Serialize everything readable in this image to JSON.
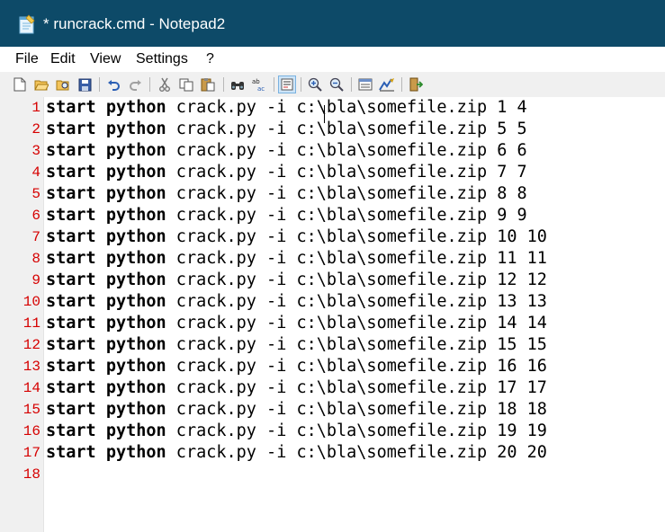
{
  "window": {
    "title": "* runcrack.cmd - Notepad2"
  },
  "menu": [
    {
      "label": "File"
    },
    {
      "label": "Edit"
    },
    {
      "label": "View"
    },
    {
      "label": "Settings"
    },
    {
      "label": "?"
    }
  ],
  "toolbar": {
    "buttons": [
      {
        "name": "new-file-icon"
      },
      {
        "name": "open-folder-icon"
      },
      {
        "name": "browse-icon"
      },
      {
        "name": "save-icon"
      },
      {
        "name": "undo-icon"
      },
      {
        "name": "redo-icon"
      },
      {
        "name": "cut-icon"
      },
      {
        "name": "copy-icon"
      },
      {
        "name": "paste-icon"
      },
      {
        "name": "find-icon"
      },
      {
        "name": "replace-icon"
      },
      {
        "name": "word-wrap-icon"
      },
      {
        "name": "zoom-in-icon"
      },
      {
        "name": "zoom-out-icon"
      },
      {
        "name": "scheme-icon"
      },
      {
        "name": "customize-schemes-icon"
      },
      {
        "name": "exit-icon"
      }
    ]
  },
  "editor": {
    "lines": [
      {
        "num": "1",
        "kw1": "start",
        "kw2": "python",
        "rest": " crack.py -i c:\\bla\\somefile.zip 1 4"
      },
      {
        "num": "2",
        "kw1": "start",
        "kw2": "python",
        "rest": " crack.py -i c:\\bla\\somefile.zip 5 5"
      },
      {
        "num": "3",
        "kw1": "start",
        "kw2": "python",
        "rest": " crack.py -i c:\\bla\\somefile.zip 6 6"
      },
      {
        "num": "4",
        "kw1": "start",
        "kw2": "python",
        "rest": " crack.py -i c:\\bla\\somefile.zip 7 7"
      },
      {
        "num": "5",
        "kw1": "start",
        "kw2": "python",
        "rest": " crack.py -i c:\\bla\\somefile.zip 8 8"
      },
      {
        "num": "6",
        "kw1": "start",
        "kw2": "python",
        "rest": " crack.py -i c:\\bla\\somefile.zip 9 9"
      },
      {
        "num": "7",
        "kw1": "start",
        "kw2": "python",
        "rest": " crack.py -i c:\\bla\\somefile.zip 10 10"
      },
      {
        "num": "8",
        "kw1": "start",
        "kw2": "python",
        "rest": " crack.py -i c:\\bla\\somefile.zip 11 11"
      },
      {
        "num": "9",
        "kw1": "start",
        "kw2": "python",
        "rest": " crack.py -i c:\\bla\\somefile.zip 12 12"
      },
      {
        "num": "10",
        "kw1": "start",
        "kw2": "python",
        "rest": " crack.py -i c:\\bla\\somefile.zip 13 13"
      },
      {
        "num": "11",
        "kw1": "start",
        "kw2": "python",
        "rest": " crack.py -i c:\\bla\\somefile.zip 14 14"
      },
      {
        "num": "12",
        "kw1": "start",
        "kw2": "python",
        "rest": " crack.py -i c:\\bla\\somefile.zip 15 15"
      },
      {
        "num": "13",
        "kw1": "start",
        "kw2": "python",
        "rest": " crack.py -i c:\\bla\\somefile.zip 16 16"
      },
      {
        "num": "14",
        "kw1": "start",
        "kw2": "python",
        "rest": " crack.py -i c:\\bla\\somefile.zip 17 17"
      },
      {
        "num": "15",
        "kw1": "start",
        "kw2": "python",
        "rest": " crack.py -i c:\\bla\\somefile.zip 18 18"
      },
      {
        "num": "16",
        "kw1": "start",
        "kw2": "python",
        "rest": " crack.py -i c:\\bla\\somefile.zip 19 19"
      },
      {
        "num": "17",
        "kw1": "start",
        "kw2": "python",
        "rest": " crack.py -i c:\\bla\\somefile.zip 20 20"
      },
      {
        "num": "18",
        "kw1": "",
        "kw2": "",
        "rest": ""
      }
    ]
  },
  "colors": {
    "titlebar": "#0d4a68",
    "line_number": "#d60000",
    "gutter": "#f0f0f0"
  }
}
